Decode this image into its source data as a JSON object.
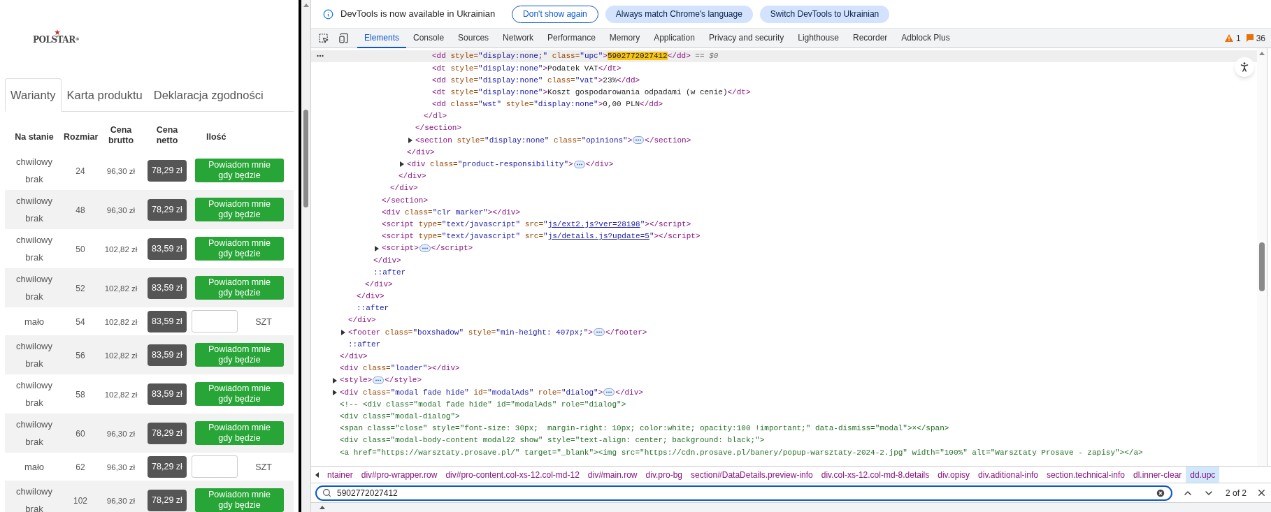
{
  "page": {
    "logo": {
      "text": "POLSTAR",
      "mark": "®"
    },
    "tabs": [
      {
        "label": "Warianty",
        "selected": true
      },
      {
        "label": "Karta produktu",
        "selected": false
      },
      {
        "label": "Deklaracja zgodności",
        "selected": false
      }
    ],
    "table": {
      "columns": [
        "Na stanie",
        "Rozmiar",
        "Cena brutto",
        "Cena netto",
        "Ilość"
      ],
      "rows": [
        {
          "kind": "notify",
          "status": "chwilowy brak",
          "size": "24",
          "gross": "96,30 zł",
          "net": "78,29 zł",
          "action": "Powiadom mnie gdy będzie"
        },
        {
          "kind": "notify",
          "status": "chwilowy brak",
          "size": "48",
          "gross": "96,30 zł",
          "net": "78,29 zł",
          "action": "Powiadom mnie gdy będzie"
        },
        {
          "kind": "notify",
          "status": "chwilowy brak",
          "size": "50",
          "gross": "102,82 zł",
          "net": "83,59 zł",
          "action": "Powiadom mnie gdy będzie"
        },
        {
          "kind": "notify",
          "status": "chwilowy brak",
          "size": "52",
          "gross": "102,82 zł",
          "net": "83,59 zł",
          "action": "Powiadom mnie gdy będzie"
        },
        {
          "kind": "quantity",
          "status": "mało",
          "size": "54",
          "gross": "102,82 zł",
          "net": "83,59 zł",
          "unit": "SZT"
        },
        {
          "kind": "notify",
          "status": "chwilowy brak",
          "size": "56",
          "gross": "102,82 zł",
          "net": "83,59 zł",
          "action": "Powiadom mnie gdy będzie"
        },
        {
          "kind": "notify",
          "status": "chwilowy brak",
          "size": "58",
          "gross": "102,82 zł",
          "net": "83,59 zł",
          "action": "Powiadom mnie gdy będzie"
        },
        {
          "kind": "notify",
          "status": "chwilowy brak",
          "size": "60",
          "gross": "96,30 zł",
          "net": "78,29 zł",
          "action": "Powiadom mnie gdy będzie"
        },
        {
          "kind": "quantity",
          "status": "mało",
          "size": "62",
          "gross": "96,30 zł",
          "net": "78,29 zł",
          "unit": "SZT"
        },
        {
          "kind": "notify",
          "status": "chwilowy brak",
          "size": "102",
          "gross": "96,30 zł",
          "net": "78,29 zł",
          "action": "Powiadom mnie gdy będzie"
        }
      ]
    }
  },
  "devtools": {
    "banner": {
      "message": "DevTools is now available in Ukrainian",
      "buttons": [
        {
          "label": "Don't show again",
          "kind": "outline"
        },
        {
          "label": "Always match Chrome's language",
          "kind": "filled"
        },
        {
          "label": "Switch DevTools to Ukrainian",
          "kind": "filled"
        }
      ]
    },
    "tabs": [
      {
        "label": "Elements",
        "selected": true
      },
      {
        "label": "Console",
        "selected": false
      },
      {
        "label": "Sources",
        "selected": false
      },
      {
        "label": "Network",
        "selected": false
      },
      {
        "label": "Performance",
        "selected": false
      },
      {
        "label": "Memory",
        "selected": false
      },
      {
        "label": "Application",
        "selected": false
      },
      {
        "label": "Privacy and security",
        "selected": false
      },
      {
        "label": "Lighthouse",
        "selected": false
      },
      {
        "label": "Recorder",
        "selected": false
      },
      {
        "label": "Adblock Plus",
        "selected": false
      }
    ],
    "warnings": "1",
    "issues": "36",
    "dom": [
      {
        "children": [
          {
            "children": [
              {
                "children": [
                  {
                    "children": [
                      {
                        "children": [
                          {
                            "children": [
                              {
                                "children": [
                                  {
                                    "children": [
                                      {
                                        "children": [
                                          {
                                            "children": [
                                              {
                                                "children": [
                                                  {
                                                    "kind": "line",
                                                    "selected": true,
                                                    "tokens": [
                                                      {
                                                        "kind": "tag",
                                                        "text": "<dd"
                                                      },
                                                      {
                                                        "kind": "attr",
                                                        "text": " style="
                                                      },
                                                      {
                                                        "kind": "val",
                                                        "text": "\"display:none;\""
                                                      },
                                                      {
                                                        "kind": "attr",
                                                        "text": " class="
                                                      },
                                                      {
                                                        "kind": "val",
                                                        "text": "\"upc\""
                                                      },
                                                      {
                                                        "kind": "tag",
                                                        "text": ">"
                                                      },
                                                      {
                                                        "kind": "hl",
                                                        "text": "5902772027412"
                                                      },
                                                      {
                                                        "kind": "tag",
                                                        "text": "</dd>"
                                                      },
                                                      {
                                                        "kind": "meta",
                                                        "text": " == $0"
                                                      }
                                                    ]
                                                  },
                                                  {
                                                    "kind": "line",
                                                    "selected": false,
                                                    "tokens": [
                                                      {
                                                        "kind": "tag",
                                                        "text": "<dt"
                                                      },
                                                      {
                                                        "kind": "attr",
                                                        "text": " style="
                                                      },
                                                      {
                                                        "kind": "val",
                                                        "text": "\"display:none\""
                                                      },
                                                      {
                                                        "kind": "tag",
                                                        "text": ">"
                                                      },
                                                      {
                                                        "kind": "text",
                                                        "text": "Podatek VAT"
                                                      },
                                                      {
                                                        "kind": "tag",
                                                        "text": "</dt>"
                                                      }
                                                    ]
                                                  },
                                                  {
                                                    "kind": "line",
                                                    "selected": false,
                                                    "tokens": [
                                                      {
                                                        "kind": "tag",
                                                        "text": "<dd"
                                                      },
                                                      {
                                                        "kind": "attr",
                                                        "text": " style="
                                                      },
                                                      {
                                                        "kind": "val",
                                                        "text": "\"display:none\""
                                                      },
                                                      {
                                                        "kind": "attr",
                                                        "text": " class="
                                                      },
                                                      {
                                                        "kind": "val",
                                                        "text": "\"vat\""
                                                      },
                                                      {
                                                        "kind": "tag",
                                                        "text": ">"
                                                      },
                                                      {
                                                        "kind": "text",
                                                        "text": "23%"
                                                      },
                                                      {
                                                        "kind": "tag",
                                                        "text": "</dd>"
                                                      }
                                                    ]
                                                  },
                                                  {
                                                    "kind": "line",
                                                    "selected": false,
                                                    "tokens": [
                                                      {
                                                        "kind": "tag",
                                                        "text": "<dt"
                                                      },
                                                      {
                                                        "kind": "attr",
                                                        "text": " style="
                                                      },
                                                      {
                                                        "kind": "val",
                                                        "text": "\"display:none\""
                                                      },
                                                      {
                                                        "kind": "tag",
                                                        "text": ">"
                                                      },
                                                      {
                                                        "kind": "text",
                                                        "text": "Koszt gospodarowania odpadami (w cenie)"
                                                      },
                                                      {
                                                        "kind": "tag",
                                                        "text": "</dt>"
                                                      }
                                                    ]
                                                  },
                                                  {
                                                    "kind": "line",
                                                    "selected": false,
                                                    "tokens": [
                                                      {
                                                        "kind": "tag",
                                                        "text": "<dd"
                                                      },
                                                      {
                                                        "kind": "attr",
                                                        "text": " class="
                                                      },
                                                      {
                                                        "kind": "val",
                                                        "text": "\"wst\""
                                                      },
                                                      {
                                                        "kind": "attr",
                                                        "text": " style="
                                                      },
                                                      {
                                                        "kind": "val",
                                                        "text": "\"display:none\""
                                                      },
                                                      {
                                                        "kind": "tag",
                                                        "text": ">"
                                                      },
                                                      {
                                                        "kind": "text",
                                                        "text": "0,00 PLN"
                                                      },
                                                      {
                                                        "kind": "tag",
                                                        "text": "</dd>"
                                                      }
                                                    ]
                                                  }
                                                ]
                                              },
                                              {
                                                "kind": "line",
                                                "selected": false,
                                                "tokens": [
                                                  {
                                                    "kind": "tag",
                                                    "text": "</dl>"
                                                  }
                                                ]
                                              }
                                            ]
                                          },
                                          {
                                            "kind": "line",
                                            "selected": false,
                                            "tokens": [
                                              {
                                                "kind": "tag",
                                                "text": "</section>"
                                              }
                                            ]
                                          },
                                          {
                                            "kind": "collapsed",
                                            "selected": false,
                                            "tokens": [
                                              {
                                                "kind": "tag",
                                                "text": "<section"
                                              },
                                              {
                                                "kind": "attr",
                                                "text": " style="
                                              },
                                              {
                                                "kind": "val",
                                                "text": "\"display:none\""
                                              },
                                              {
                                                "kind": "attr",
                                                "text": " class="
                                              },
                                              {
                                                "kind": "val",
                                                "text": "\"opinions\""
                                              },
                                              {
                                                "kind": "tag",
                                                "text": ">"
                                              },
                                              {
                                                "kind": "more"
                                              },
                                              {
                                                "kind": "tag",
                                                "text": "</section>"
                                              }
                                            ]
                                          }
                                        ]
                                      },
                                      {
                                        "kind": "line",
                                        "selected": false,
                                        "tokens": [
                                          {
                                            "kind": "tag",
                                            "text": "</div>"
                                          }
                                        ]
                                      },
                                      {
                                        "kind": "collapsed",
                                        "selected": false,
                                        "tokens": [
                                          {
                                            "kind": "tag",
                                            "text": "<div"
                                          },
                                          {
                                            "kind": "attr",
                                            "text": " class="
                                          },
                                          {
                                            "kind": "val",
                                            "text": "\"product-responsibility\""
                                          },
                                          {
                                            "kind": "tag",
                                            "text": ">"
                                          },
                                          {
                                            "kind": "more"
                                          },
                                          {
                                            "kind": "tag",
                                            "text": "</div>"
                                          }
                                        ]
                                      }
                                    ]
                                  },
                                  {
                                    "kind": "line",
                                    "selected": false,
                                    "tokens": [
                                      {
                                        "kind": "tag",
                                        "text": "</div>"
                                      }
                                    ]
                                  }
                                ]
                              },
                              {
                                "kind": "line",
                                "selected": false,
                                "tokens": [
                                  {
                                    "kind": "tag",
                                    "text": "</div>"
                                  }
                                ]
                              }
                            ]
                          },
                          {
                            "kind": "line",
                            "selected": false,
                            "tokens": [
                              {
                                "kind": "tag",
                                "text": "</section>"
                              }
                            ]
                          },
                          {
                            "kind": "line",
                            "selected": false,
                            "tokens": [
                              {
                                "kind": "tag",
                                "text": "<div"
                              },
                              {
                                "kind": "attr",
                                "text": " class="
                              },
                              {
                                "kind": "val",
                                "text": "\"clr marker\""
                              },
                              {
                                "kind": "tag",
                                "text": "></div>"
                              }
                            ]
                          },
                          {
                            "kind": "line",
                            "selected": false,
                            "tokens": [
                              {
                                "kind": "tag",
                                "text": "<script"
                              },
                              {
                                "kind": "attr",
                                "text": " type="
                              },
                              {
                                "kind": "val",
                                "text": "\"text/javascript\""
                              },
                              {
                                "kind": "attr",
                                "text": " src="
                              },
                              {
                                "kind": "val",
                                "text": "\""
                              },
                              {
                                "kind": "link",
                                "text": "js/ext2.js?ver=28198"
                              },
                              {
                                "kind": "val",
                                "text": "\""
                              },
                              {
                                "kind": "tag",
                                "text": "></script>"
                              }
                            ]
                          },
                          {
                            "kind": "line",
                            "selected": false,
                            "tokens": [
                              {
                                "kind": "tag",
                                "text": "<script"
                              },
                              {
                                "kind": "attr",
                                "text": " type="
                              },
                              {
                                "kind": "val",
                                "text": "\"text/javascript\""
                              },
                              {
                                "kind": "attr",
                                "text": " src="
                              },
                              {
                                "kind": "val",
                                "text": "\""
                              },
                              {
                                "kind": "link",
                                "text": "js/details.js?update=5"
                              },
                              {
                                "kind": "val",
                                "text": "\""
                              },
                              {
                                "kind": "tag",
                                "text": "></script>"
                              }
                            ]
                          },
                          {
                            "kind": "collapsed",
                            "selected": false,
                            "tokens": [
                              {
                                "kind": "tag",
                                "text": "<script>"
                              },
                              {
                                "kind": "more"
                              },
                              {
                                "kind": "tag",
                                "text": "</script>"
                              }
                            ]
                          }
                        ]
                      },
                      {
                        "kind": "line",
                        "selected": false,
                        "tokens": [
                          {
                            "kind": "tag",
                            "text": "</div>"
                          }
                        ]
                      },
                      {
                        "kind": "line",
                        "selected": false,
                        "tokens": [
                          {
                            "kind": "pseudo",
                            "text": "::after"
                          }
                        ]
                      }
                    ]
                  },
                  {
                    "kind": "line",
                    "selected": false,
                    "tokens": [
                      {
                        "kind": "tag",
                        "text": "</div>"
                      }
                    ]
                  }
                ]
              },
              {
                "kind": "line",
                "selected": false,
                "tokens": [
                  {
                    "kind": "tag",
                    "text": "</div>"
                  }
                ]
              },
              {
                "kind": "line",
                "selected": false,
                "tokens": [
                  {
                    "kind": "pseudo",
                    "text": "::after"
                  }
                ]
              }
            ]
          },
          {
            "kind": "line",
            "selected": false,
            "tokens": [
              {
                "kind": "tag",
                "text": "</div>"
              }
            ]
          },
          {
            "kind": "collapsed",
            "selected": false,
            "tokens": [
              {
                "kind": "tag",
                "text": "<footer"
              },
              {
                "kind": "attr",
                "text": " class="
              },
              {
                "kind": "val",
                "text": "\"boxshadow\""
              },
              {
                "kind": "attr",
                "text": " style="
              },
              {
                "kind": "val",
                "text": "\"min-height: 407px;\""
              },
              {
                "kind": "tag",
                "text": ">"
              },
              {
                "kind": "more"
              },
              {
                "kind": "tag",
                "text": "</footer>"
              }
            ]
          },
          {
            "kind": "line",
            "selected": false,
            "tokens": [
              {
                "kind": "pseudo",
                "text": "::after"
              }
            ]
          }
        ]
      },
      {
        "kind": "line",
        "selected": false,
        "tokens": [
          {
            "kind": "tag",
            "text": "</div>"
          }
        ]
      },
      {
        "kind": "line",
        "selected": false,
        "tokens": [
          {
            "kind": "tag",
            "text": "<div"
          },
          {
            "kind": "attr",
            "text": " class="
          },
          {
            "kind": "val",
            "text": "\"loader\""
          },
          {
            "kind": "tag",
            "text": "></div>"
          }
        ]
      },
      {
        "kind": "collapsed",
        "selected": false,
        "tokens": [
          {
            "kind": "tag",
            "text": "<style>"
          },
          {
            "kind": "more"
          },
          {
            "kind": "tag",
            "text": "</style>"
          }
        ]
      },
      {
        "kind": "collapsed",
        "selected": false,
        "tokens": [
          {
            "kind": "tag",
            "text": "<div"
          },
          {
            "kind": "attr",
            "text": " class="
          },
          {
            "kind": "val",
            "text": "\"modal fade hide\""
          },
          {
            "kind": "attr",
            "text": " id="
          },
          {
            "kind": "val",
            "text": "\"modalAds\""
          },
          {
            "kind": "attr",
            "text": " role="
          },
          {
            "kind": "val",
            "text": "\"dialog\""
          },
          {
            "kind": "tag",
            "text": ">"
          },
          {
            "kind": "more"
          },
          {
            "kind": "tag",
            "text": "</div>"
          }
        ]
      },
      {
        "kind": "line",
        "selected": false,
        "tokens": [
          {
            "kind": "comment",
            "text": "<!-- <div class=\"modal fade hide\" id=\"modalAds\" role=\"dialog\">"
          }
        ]
      },
      {
        "kind": "line",
        "selected": false,
        "tokens": [
          {
            "kind": "comment",
            "text": "<div class=\"modal-dialog\">"
          }
        ]
      },
      {
        "kind": "line",
        "selected": false,
        "tokens": [
          {
            "kind": "comment",
            "text": "<span class=\"close\" style=\"font-size: 30px;  margin-right: 10px; color:white; opacity:100 !important;\" data-dismiss=\"modal\">×</span>"
          }
        ]
      },
      {
        "kind": "line",
        "selected": false,
        "tokens": [
          {
            "kind": "comment",
            "text": "<div class=\"modal-body-content modal22 show\" style=\"text-align: center; background: black;\">"
          }
        ]
      },
      {
        "kind": "line",
        "selected": false,
        "tokens": [
          {
            "kind": "comment",
            "text": "<a href=\"https://warsztaty.prosave.pl/\" target=\"_blank\"><img src=\"https://cdn.prosave.pl/banery/popup-warsztaty-2024-2.jpg\" width=\"100%\" alt=\"Warsztaty Prosave - zapisy\"></a>"
          }
        ]
      }
    ],
    "breadcrumbs": [
      {
        "label": "ntainer",
        "selected": false
      },
      {
        "label": "div#pro-wrapper.row",
        "selected": false
      },
      {
        "label": "div#pro-content.col-xs-12.col-md-12",
        "selected": false
      },
      {
        "label": "div#main.row",
        "selected": false
      },
      {
        "label": "div.pro-bg",
        "selected": false
      },
      {
        "label": "section#DataDetails.preview-info",
        "selected": false
      },
      {
        "label": "div.col-xs-12.col-md-8.details",
        "selected": false
      },
      {
        "label": "div.opisy",
        "selected": false
      },
      {
        "label": "div.aditional-info",
        "selected": false
      },
      {
        "label": "section.technical-info",
        "selected": false
      },
      {
        "label": "dl.inner-clear",
        "selected": false
      },
      {
        "label": "dd.upc",
        "selected": true
      }
    ],
    "search": {
      "value": "5902772027412",
      "count": "2 of 2"
    }
  }
}
